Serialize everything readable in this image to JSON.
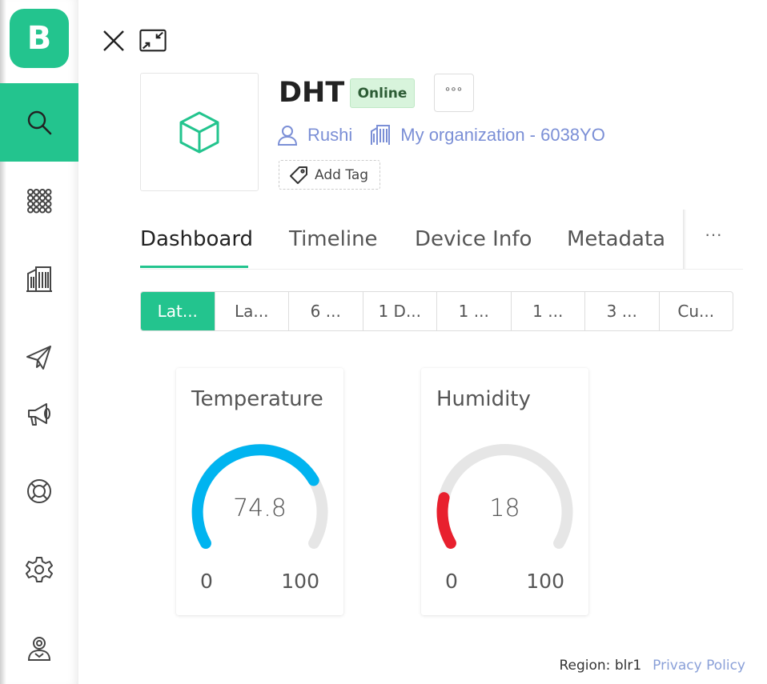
{
  "sidebar": {
    "logo_letter": "B",
    "items": [
      {
        "name": "search"
      },
      {
        "name": "devices-grid"
      },
      {
        "name": "organizations"
      },
      {
        "name": "messages"
      },
      {
        "name": "announcements"
      },
      {
        "name": "help"
      },
      {
        "name": "settings"
      },
      {
        "name": "profile"
      }
    ],
    "accent": "#23c48e"
  },
  "device": {
    "name": "DHT",
    "status": "Online",
    "more": "°°°",
    "owner": "Rushi",
    "organization": "My organization - 6038YO",
    "add_tag": "Add Tag"
  },
  "tabs": [
    "Dashboard",
    "Timeline",
    "Device Info",
    "Metadata"
  ],
  "tabs_more": "···",
  "ranges": [
    "Lat...",
    "La...",
    "6 ...",
    "1 D...",
    "1 ...",
    "1 ...",
    "3 ...",
    "Cu..."
  ],
  "widgets": [
    {
      "title": "Temperature",
      "value": "74.8",
      "min": "0",
      "max": "100",
      "fraction": 0.748,
      "color": "#00b4f0"
    },
    {
      "title": "Humidity",
      "value": "18",
      "min": "0",
      "max": "100",
      "fraction": 0.18,
      "color": "#e8202e"
    }
  ],
  "footer": {
    "region": "Region: blr1",
    "privacy": "Privacy Policy"
  }
}
